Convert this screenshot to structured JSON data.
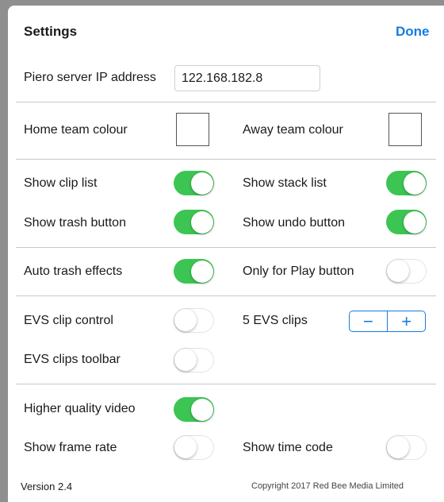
{
  "header": {
    "title": "Settings",
    "done_label": "Done"
  },
  "server": {
    "label": "Piero server IP address",
    "value": "122.168.182.8"
  },
  "colours": {
    "home_label": "Home team colour",
    "away_label": "Away team colour",
    "home_value": "#ffffff",
    "away_value": "#ffffff"
  },
  "lists": {
    "show_clip_list": {
      "label": "Show clip list",
      "on": true
    },
    "show_stack_list": {
      "label": "Show stack list",
      "on": true
    },
    "show_trash_button": {
      "label": "Show trash button",
      "on": true
    },
    "show_undo_button": {
      "label": "Show undo button",
      "on": true
    }
  },
  "trash": {
    "auto_trash_effects": {
      "label": "Auto trash effects",
      "on": true
    },
    "only_for_play": {
      "label": "Only for Play button",
      "on": false
    }
  },
  "evs": {
    "clip_control": {
      "label": "EVS clip control",
      "on": false
    },
    "clips_count_label": "5 EVS clips",
    "stepper": {
      "minus": "−",
      "plus": "+"
    },
    "clips_toolbar": {
      "label": "EVS clips toolbar",
      "on": false
    }
  },
  "video": {
    "higher_quality": {
      "label": "Higher quality video",
      "on": true
    },
    "show_frame_rate": {
      "label": "Show frame rate",
      "on": false
    },
    "show_time_code": {
      "label": "Show time code",
      "on": false
    }
  },
  "footer": {
    "version": "Version 2.4",
    "copyright": "Copyright 2017 Red Bee Media Limited"
  },
  "colors": {
    "accent": "#147ce0",
    "toggle_on": "#3cc553",
    "divider": "#c8c8c8"
  }
}
